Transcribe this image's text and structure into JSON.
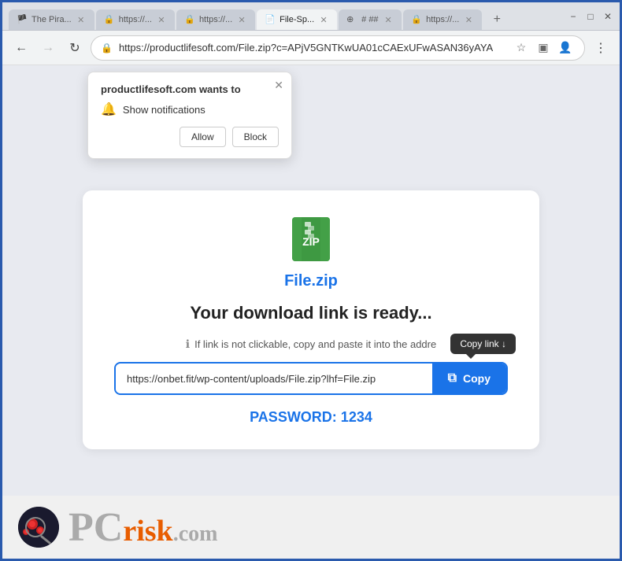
{
  "browser": {
    "tabs": [
      {
        "id": "tab1",
        "label": "The Pira...",
        "favicon": "🏴",
        "active": false
      },
      {
        "id": "tab2",
        "label": "https://...",
        "favicon": "🔒",
        "active": false
      },
      {
        "id": "tab3",
        "label": "https://...",
        "favicon": "🔒",
        "active": false
      },
      {
        "id": "tab4",
        "label": "File-Sp...",
        "favicon": "📄",
        "active": true
      },
      {
        "id": "tab5",
        "label": "# ##",
        "favicon": "⊕",
        "active": false
      },
      {
        "id": "tab6",
        "label": "https://...",
        "favicon": "🔒",
        "active": false
      }
    ],
    "new_tab_label": "+",
    "window_controls": {
      "minimize": "−",
      "maximize": "□",
      "close": "✕"
    },
    "nav": {
      "back_disabled": false,
      "forward_disabled": true,
      "reload": "↻",
      "address": "https://productlifesoft.com/File.zip?c=APjV5GNTKwUA01cCAExUFwASAN36yAYA"
    }
  },
  "notification_popup": {
    "title": "productlifesoft.com wants to",
    "notification_label": "Show notifications",
    "allow_label": "Allow",
    "block_label": "Block"
  },
  "card": {
    "file_name": "File.zip",
    "heading": "Your download link is ready...",
    "info_text": "If link is not clickable, copy and paste it into the addre",
    "tooltip_label": "Copy link ↓",
    "url_value": "https://onbet.fit/wp-content/uploads/File.zip?lhf=File.zip",
    "copy_button_label": "Copy",
    "password_label": "PASSWORD: 1234"
  },
  "footer": {
    "logo_text_pc": "PC",
    "logo_text_risk": "risk",
    "logo_text_com": ".com"
  }
}
